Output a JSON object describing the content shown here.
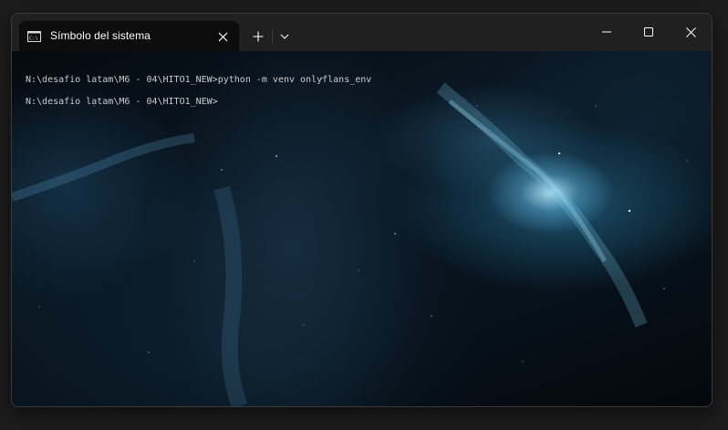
{
  "window": {
    "tab": {
      "title": "Símbolo del sistema",
      "icon": "cmd-icon"
    },
    "controls": {
      "new_tab_icon": "plus-icon",
      "dropdown_icon": "chevron-down-icon",
      "minimize_icon": "minimize-icon",
      "maximize_icon": "maximize-icon",
      "close_icon": "close-icon"
    }
  },
  "terminal": {
    "lines": [
      "N:\\desafio latam\\M6 - 04\\HITO1_NEW>python -m venv onlyflans_env",
      "N:\\desafio latam\\M6 - 04\\HITO1_NEW>"
    ],
    "background": "space-nebula"
  },
  "colors": {
    "titlebar": "#202020",
    "tab_active": "#0c0c0c",
    "text": "#cccccc"
  }
}
